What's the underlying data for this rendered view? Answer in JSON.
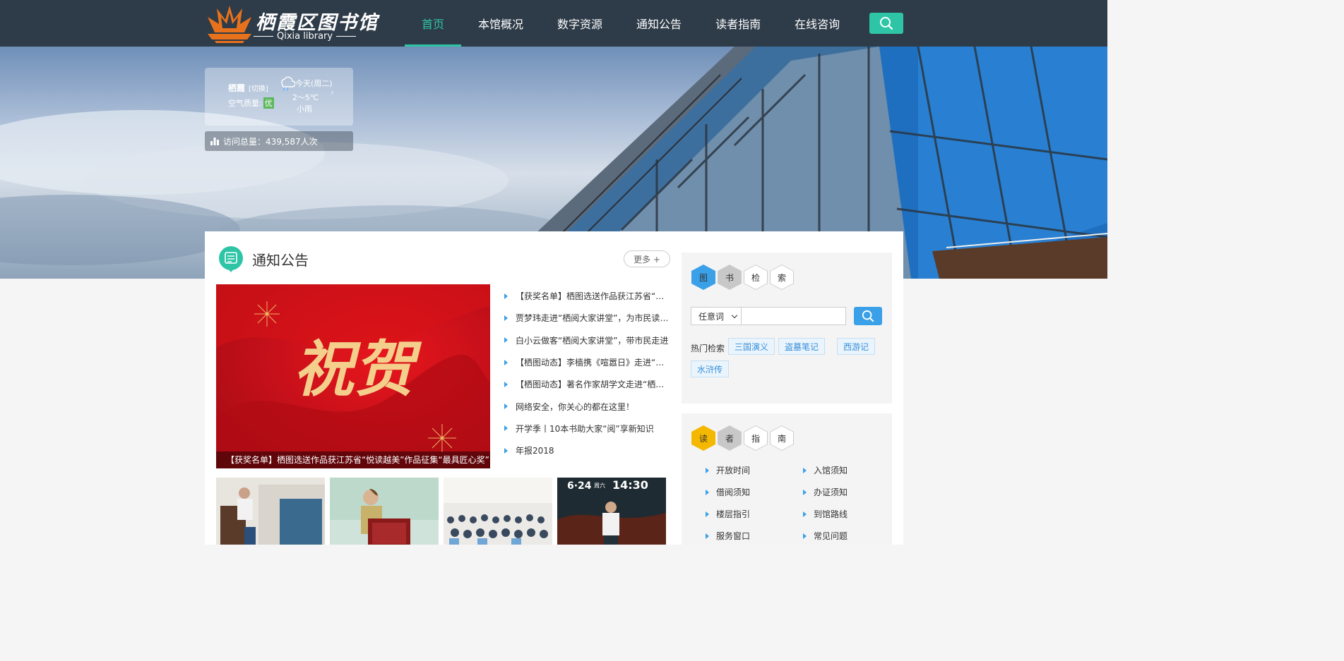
{
  "header": {
    "logo_title": "栖霞区图书馆",
    "logo_sub": "Qixia library",
    "nav": [
      "首页",
      "本馆概况",
      "数字资源",
      "通知公告",
      "读者指南",
      "在线咨询"
    ],
    "active_index": 0,
    "search_icon": "search-icon"
  },
  "weather": {
    "city": "栖霞",
    "switch": "[切换]",
    "air_label": "空气质量:",
    "air_value": "优",
    "today": "今天(周二)",
    "temp": "2～5℃",
    "condition": "小雨",
    "icon": "rain-cloud-icon"
  },
  "visits": {
    "text": "访问总量：439,587人次",
    "icon": "bar-chart-icon"
  },
  "notice": {
    "title": "通知公告",
    "more": "更多 +",
    "feature_caption": "【获奖名单】栖图选送作品获江苏省“悦读越美”作品征集“最具匠心奖”！",
    "feature_text": "祝贺",
    "items": [
      "【获奖名单】栖图选送作品获江苏省“悦读越美”作品征集“最具匠心奖”！",
      "贾梦玮走进“栖阅大家讲堂”，为市民读者分享",
      "白小云做客“栖阅大家讲堂”，带市民走进",
      "【栖图动态】李樯携《喧嚣日》走进“栖阅大家讲堂”",
      "【栖图动态】著名作家胡学文走进“栖阅大家讲堂”",
      "网络安全，你关心的都在这里！",
      "开学季丨10本书助大家“阅”享新知识",
      "年报2018"
    ],
    "thumb4_date": "6·24",
    "thumb4_week": "周六",
    "thumb4_time": "14:30"
  },
  "book_search": {
    "hexes": [
      "图",
      "书",
      "检",
      "索"
    ],
    "select_value": "任意词",
    "input_value": "",
    "hot_label": "热门检索",
    "hot_tags": [
      "三国演义",
      "盗墓笔记",
      "西游记",
      "水浒传"
    ]
  },
  "reader_guide": {
    "hexes": [
      "读",
      "者",
      "指",
      "南"
    ],
    "links": [
      "开放时间",
      "入馆须知",
      "借阅须知",
      "办证须知",
      "楼层指引",
      "到馆路线",
      "服务窗口",
      "常见问题"
    ]
  },
  "colors": {
    "header_bg": "#2e3b48",
    "accent": "#2ec5a6",
    "link_blue": "#3aa0e8",
    "gold": "#f5b800"
  }
}
